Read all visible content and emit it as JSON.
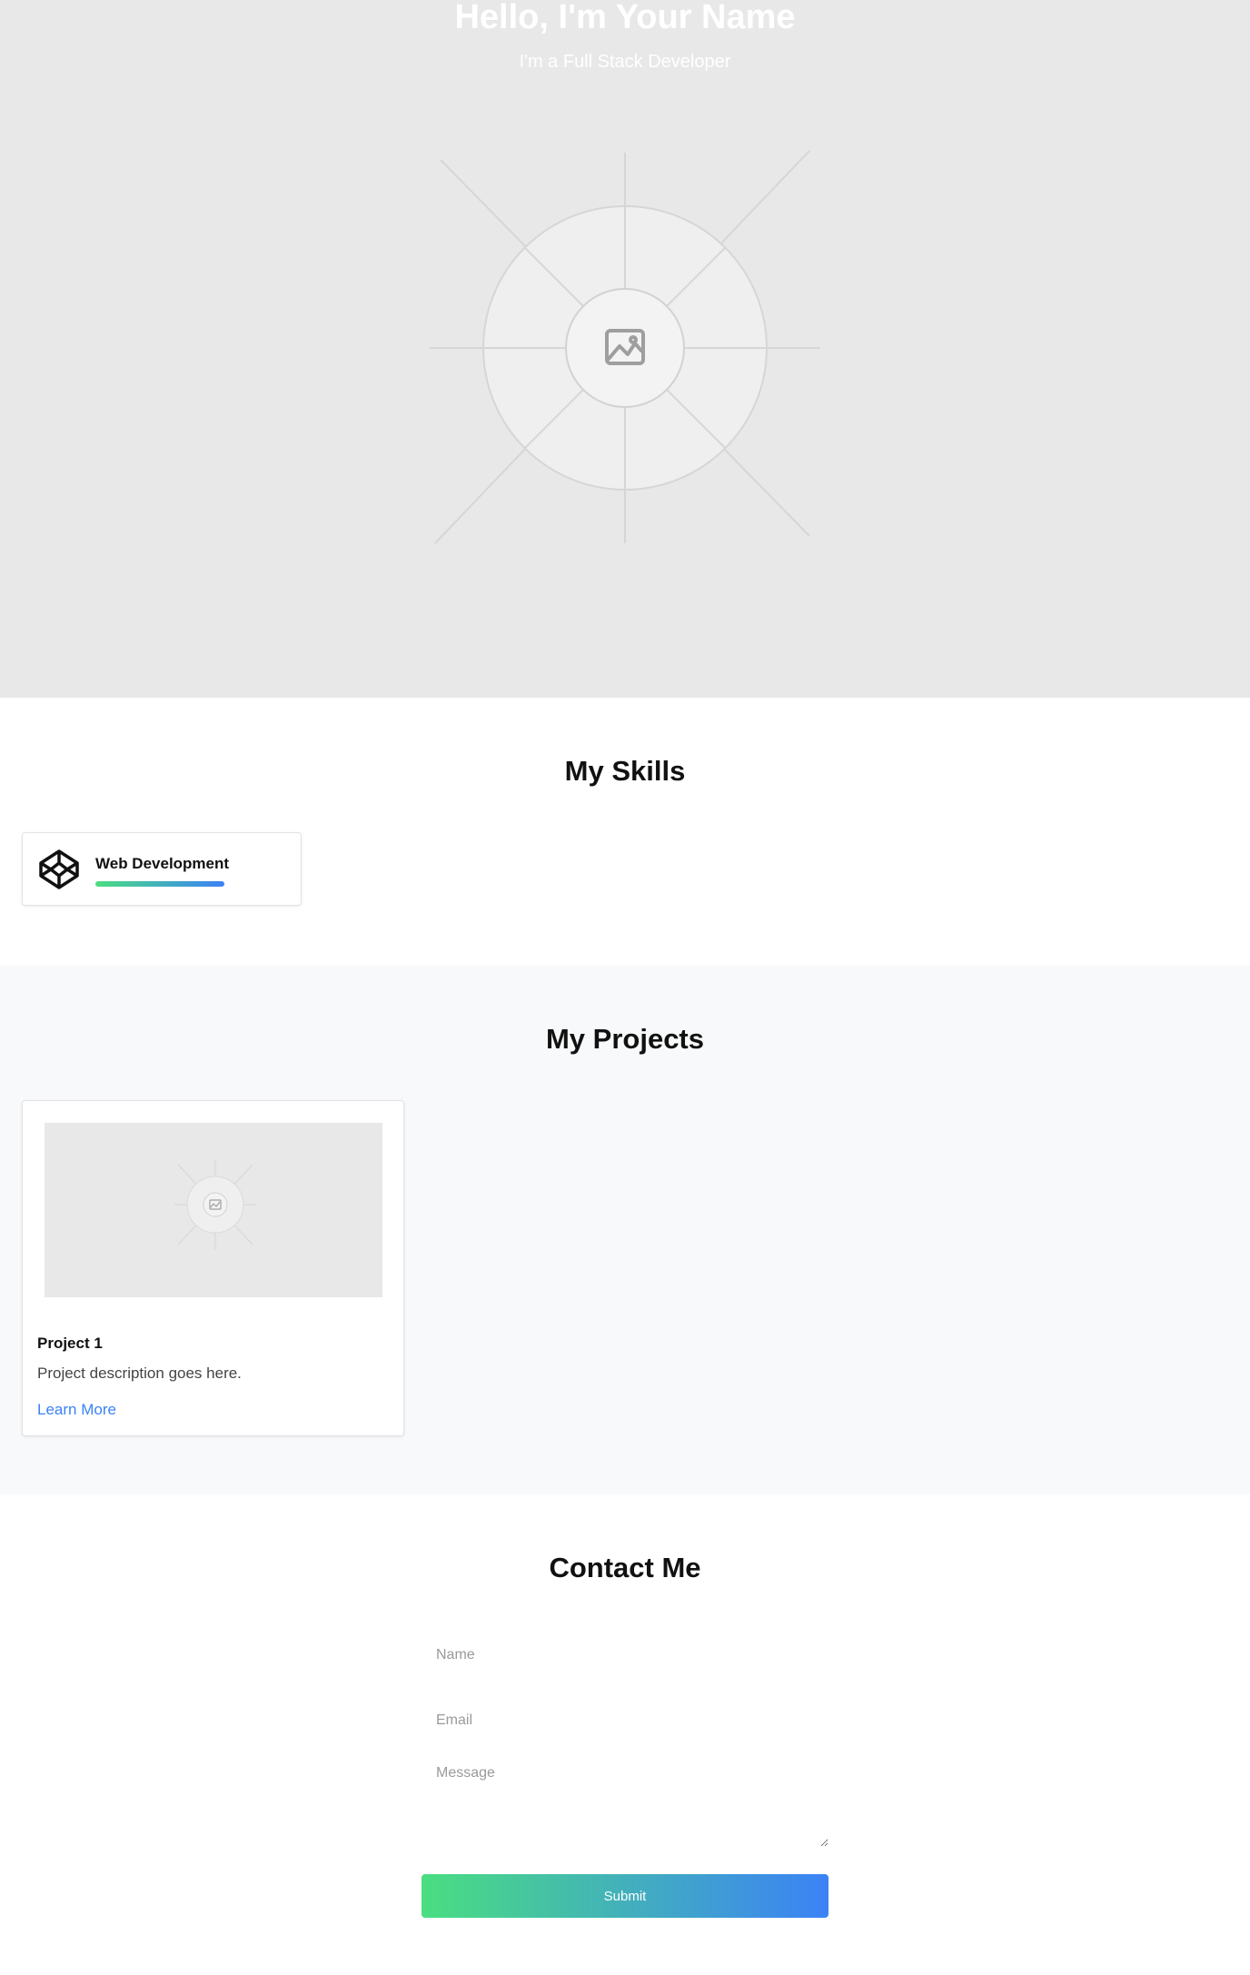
{
  "hero": {
    "title": "Hello, I'm Your Name",
    "subtitle": "I'm a Full Stack Developer",
    "image_icon": "image-placeholder-icon"
  },
  "skills": {
    "title": "My Skills",
    "items": [
      {
        "label": "Web Development",
        "icon": "codepen-icon",
        "level": 1.0
      }
    ]
  },
  "projects": {
    "title": "My Projects",
    "items": [
      {
        "title": "Project 1",
        "description": "Project description goes here.",
        "link_label": "Learn More",
        "image_icon": "image-placeholder-icon"
      }
    ]
  },
  "contact": {
    "title": "Contact Me",
    "name_placeholder": "Name",
    "email_placeholder": "Email",
    "message_placeholder": "Message",
    "submit_label": "Submit"
  },
  "colors": {
    "accent_start": "#4ade80",
    "accent_end": "#3b82f6",
    "link": "#3b82f6",
    "hero_bg": "#e8e8e8",
    "projects_bg": "#f8f9fa"
  }
}
